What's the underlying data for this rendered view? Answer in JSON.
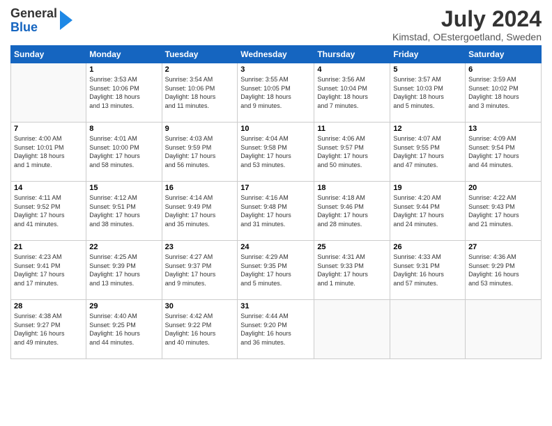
{
  "logo": {
    "general": "General",
    "blue": "Blue"
  },
  "header": {
    "title": "July 2024",
    "location": "Kimstad, OEstergoetland, Sweden"
  },
  "days_of_week": [
    "Sunday",
    "Monday",
    "Tuesday",
    "Wednesday",
    "Thursday",
    "Friday",
    "Saturday"
  ],
  "weeks": [
    [
      {
        "day": "",
        "info": ""
      },
      {
        "day": "1",
        "info": "Sunrise: 3:53 AM\nSunset: 10:06 PM\nDaylight: 18 hours\nand 13 minutes."
      },
      {
        "day": "2",
        "info": "Sunrise: 3:54 AM\nSunset: 10:06 PM\nDaylight: 18 hours\nand 11 minutes."
      },
      {
        "day": "3",
        "info": "Sunrise: 3:55 AM\nSunset: 10:05 PM\nDaylight: 18 hours\nand 9 minutes."
      },
      {
        "day": "4",
        "info": "Sunrise: 3:56 AM\nSunset: 10:04 PM\nDaylight: 18 hours\nand 7 minutes."
      },
      {
        "day": "5",
        "info": "Sunrise: 3:57 AM\nSunset: 10:03 PM\nDaylight: 18 hours\nand 5 minutes."
      },
      {
        "day": "6",
        "info": "Sunrise: 3:59 AM\nSunset: 10:02 PM\nDaylight: 18 hours\nand 3 minutes."
      }
    ],
    [
      {
        "day": "7",
        "info": "Sunrise: 4:00 AM\nSunset: 10:01 PM\nDaylight: 18 hours\nand 1 minute."
      },
      {
        "day": "8",
        "info": "Sunrise: 4:01 AM\nSunset: 10:00 PM\nDaylight: 17 hours\nand 58 minutes."
      },
      {
        "day": "9",
        "info": "Sunrise: 4:03 AM\nSunset: 9:59 PM\nDaylight: 17 hours\nand 56 minutes."
      },
      {
        "day": "10",
        "info": "Sunrise: 4:04 AM\nSunset: 9:58 PM\nDaylight: 17 hours\nand 53 minutes."
      },
      {
        "day": "11",
        "info": "Sunrise: 4:06 AM\nSunset: 9:57 PM\nDaylight: 17 hours\nand 50 minutes."
      },
      {
        "day": "12",
        "info": "Sunrise: 4:07 AM\nSunset: 9:55 PM\nDaylight: 17 hours\nand 47 minutes."
      },
      {
        "day": "13",
        "info": "Sunrise: 4:09 AM\nSunset: 9:54 PM\nDaylight: 17 hours\nand 44 minutes."
      }
    ],
    [
      {
        "day": "14",
        "info": "Sunrise: 4:11 AM\nSunset: 9:52 PM\nDaylight: 17 hours\nand 41 minutes."
      },
      {
        "day": "15",
        "info": "Sunrise: 4:12 AM\nSunset: 9:51 PM\nDaylight: 17 hours\nand 38 minutes."
      },
      {
        "day": "16",
        "info": "Sunrise: 4:14 AM\nSunset: 9:49 PM\nDaylight: 17 hours\nand 35 minutes."
      },
      {
        "day": "17",
        "info": "Sunrise: 4:16 AM\nSunset: 9:48 PM\nDaylight: 17 hours\nand 31 minutes."
      },
      {
        "day": "18",
        "info": "Sunrise: 4:18 AM\nSunset: 9:46 PM\nDaylight: 17 hours\nand 28 minutes."
      },
      {
        "day": "19",
        "info": "Sunrise: 4:20 AM\nSunset: 9:44 PM\nDaylight: 17 hours\nand 24 minutes."
      },
      {
        "day": "20",
        "info": "Sunrise: 4:22 AM\nSunset: 9:43 PM\nDaylight: 17 hours\nand 21 minutes."
      }
    ],
    [
      {
        "day": "21",
        "info": "Sunrise: 4:23 AM\nSunset: 9:41 PM\nDaylight: 17 hours\nand 17 minutes."
      },
      {
        "day": "22",
        "info": "Sunrise: 4:25 AM\nSunset: 9:39 PM\nDaylight: 17 hours\nand 13 minutes."
      },
      {
        "day": "23",
        "info": "Sunrise: 4:27 AM\nSunset: 9:37 PM\nDaylight: 17 hours\nand 9 minutes."
      },
      {
        "day": "24",
        "info": "Sunrise: 4:29 AM\nSunset: 9:35 PM\nDaylight: 17 hours\nand 5 minutes."
      },
      {
        "day": "25",
        "info": "Sunrise: 4:31 AM\nSunset: 9:33 PM\nDaylight: 17 hours\nand 1 minute."
      },
      {
        "day": "26",
        "info": "Sunrise: 4:33 AM\nSunset: 9:31 PM\nDaylight: 16 hours\nand 57 minutes."
      },
      {
        "day": "27",
        "info": "Sunrise: 4:36 AM\nSunset: 9:29 PM\nDaylight: 16 hours\nand 53 minutes."
      }
    ],
    [
      {
        "day": "28",
        "info": "Sunrise: 4:38 AM\nSunset: 9:27 PM\nDaylight: 16 hours\nand 49 minutes."
      },
      {
        "day": "29",
        "info": "Sunrise: 4:40 AM\nSunset: 9:25 PM\nDaylight: 16 hours\nand 44 minutes."
      },
      {
        "day": "30",
        "info": "Sunrise: 4:42 AM\nSunset: 9:22 PM\nDaylight: 16 hours\nand 40 minutes."
      },
      {
        "day": "31",
        "info": "Sunrise: 4:44 AM\nSunset: 9:20 PM\nDaylight: 16 hours\nand 36 minutes."
      },
      {
        "day": "",
        "info": ""
      },
      {
        "day": "",
        "info": ""
      },
      {
        "day": "",
        "info": ""
      }
    ]
  ]
}
